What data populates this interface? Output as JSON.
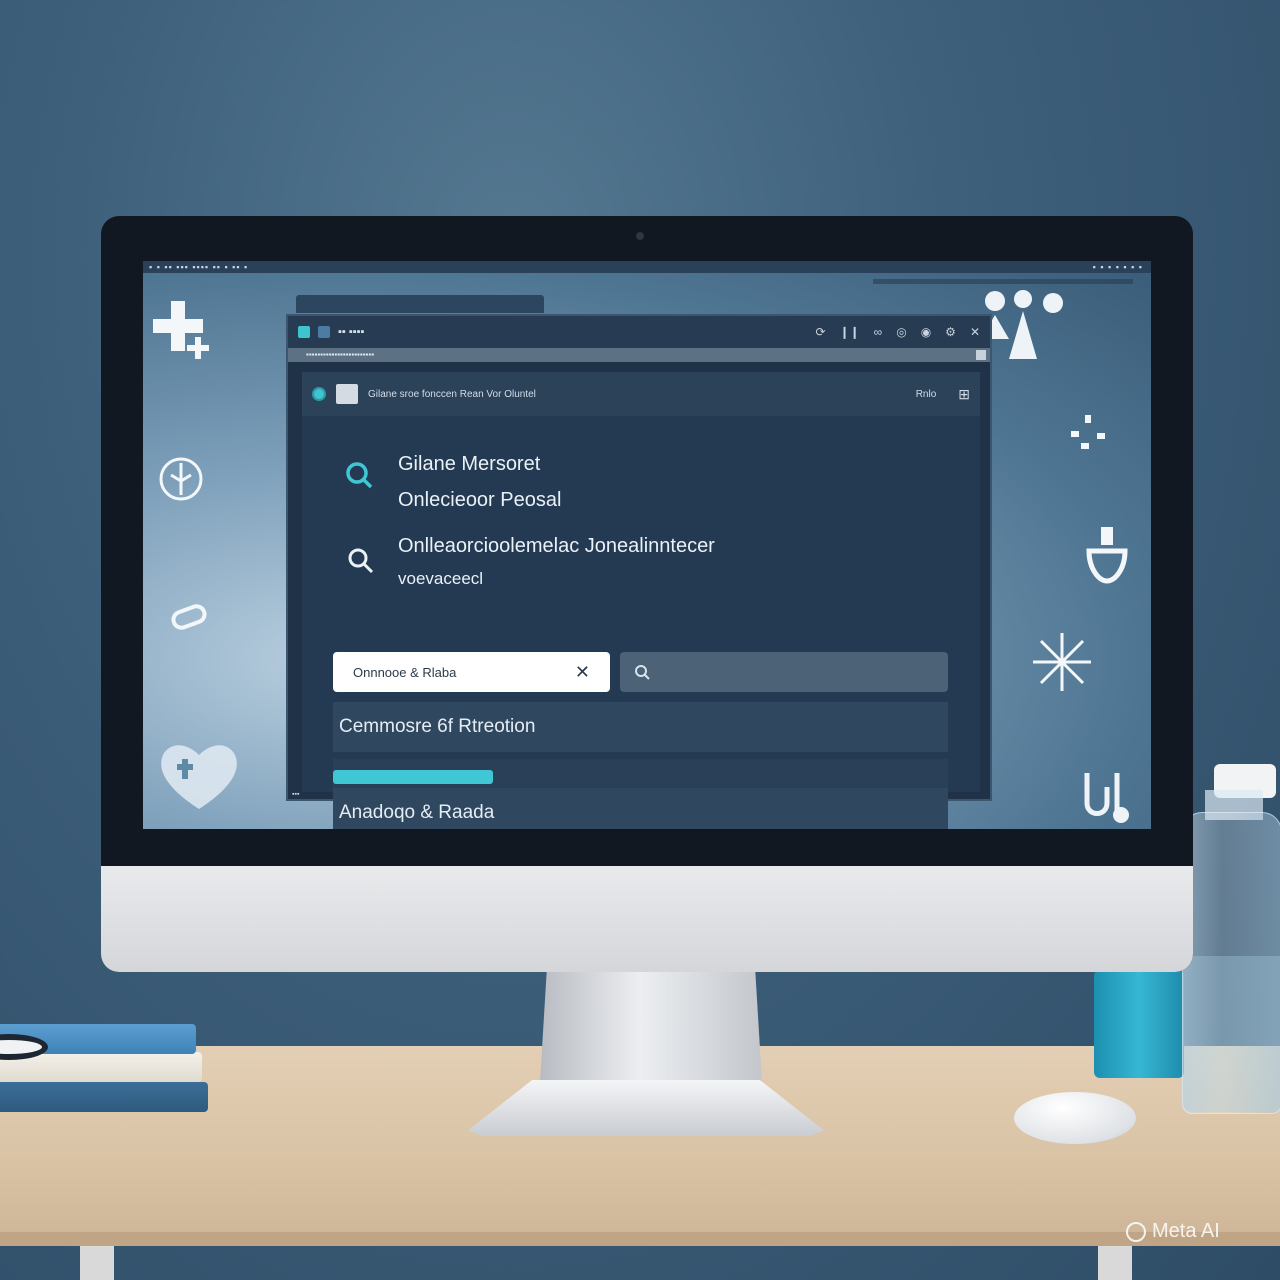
{
  "menubar": {
    "left_text": "▪ ▪ ▪▪ ▪▪▪ ▪▪▪▪ ▪▪ ▪ ▪▪ ▪",
    "right_text": "▪ ▪ ▪ ▪ ▪ ▪ ▪"
  },
  "window": {
    "title_text": "▪▪ ▪▪▪▪",
    "path_text": "▪▪▪▪▪▪▪▪▪▪▪▪▪▪▪▪▪▪▪▪▪▪▪▪",
    "header_text": "Gilane sroe fonccen Rean Vor Oluntel",
    "header_right": "Rnlo",
    "status_text": "▪▪▪"
  },
  "results": [
    {
      "title": "Gilane Mersoret",
      "subtitle": "Onlecieoor Peosal"
    },
    {
      "title": "Onlleaorcioolemelac Jonealinntecer",
      "subtitle": "voevaceecl"
    }
  ],
  "filter_chip": {
    "label": "Onnnooe & Rlaba"
  },
  "search_box": {
    "value": ""
  },
  "rows": [
    {
      "label": "Cemmosre 6f Rtreotion"
    },
    {
      "label": "Anadoqo & Raada"
    }
  ],
  "progress": {
    "fraction": 0.26
  },
  "colors": {
    "accent": "#3fc7d6",
    "window_bg": "#203247",
    "chip_bg": "#ffffff"
  },
  "icons": [
    "plus-cross-icon",
    "lungs-icon",
    "pill-icon",
    "heart-icon",
    "people-icon",
    "dots-icon",
    "mortar-icon",
    "snowflake-icon",
    "stethoscope-icon",
    "search-icon"
  ],
  "watermark": "Meta AI"
}
